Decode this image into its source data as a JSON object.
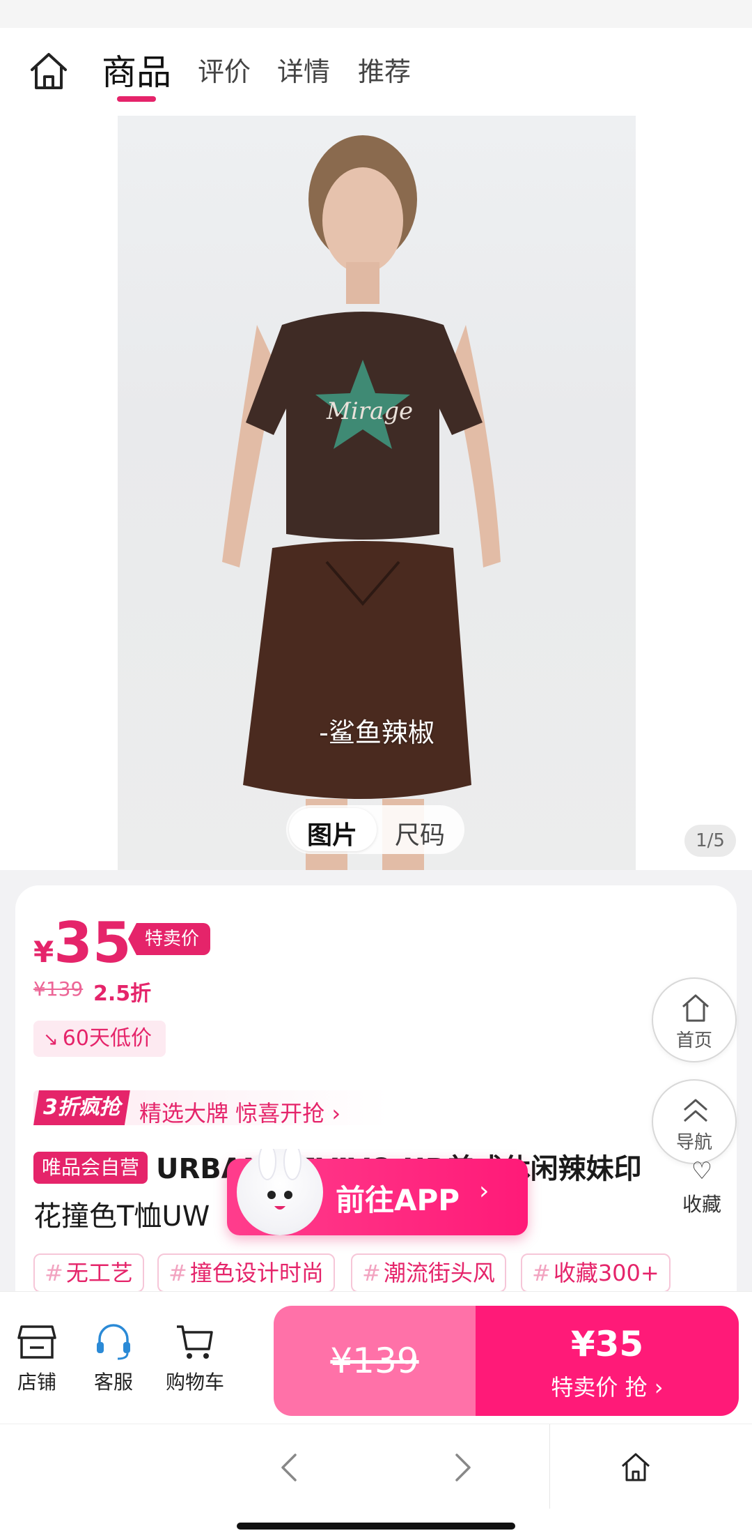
{
  "nav": {
    "tabs": [
      {
        "label": "商品",
        "active": true
      },
      {
        "label": "评价"
      },
      {
        "label": "详情"
      },
      {
        "label": "推荐"
      }
    ]
  },
  "gallery": {
    "caption": "-鲨鱼辣椒",
    "toggle": [
      "图片",
      "尺码"
    ],
    "counter": "1/5"
  },
  "product": {
    "price_symbol": "¥",
    "price": "35",
    "sale_tag": "特卖价",
    "original_price": "¥139",
    "discount": "2.5折",
    "low_price_badge": "60天低价",
    "promo_flag": "3折疯抢",
    "promo_text": "精选大牌 惊喜开抢 ›",
    "self_badge": "唯品会自营",
    "title_line1": "URBAN REVIVO UR美式休闲辣妹印",
    "title_line2": "花撞色T恤UW",
    "tags": [
      "无工艺",
      "撞色设计时尚",
      "潮流街头风",
      "收藏300+"
    ],
    "tag_hash": "#"
  },
  "floating": {
    "home_label": "首页",
    "nav_label": "导航",
    "favorite_label": "收藏"
  },
  "app_banner": {
    "label": "前往APP",
    "chevron": "›"
  },
  "actionbar": {
    "store": "店铺",
    "service": "客服",
    "cart": "购物车",
    "buy_left": "¥139",
    "buy_price": "¥35",
    "buy_sub": "特卖价 抢 ›"
  },
  "colors": {
    "accent": "#e5246a",
    "buy_right": "#ff1a78",
    "buy_left": "#ff71a8"
  }
}
